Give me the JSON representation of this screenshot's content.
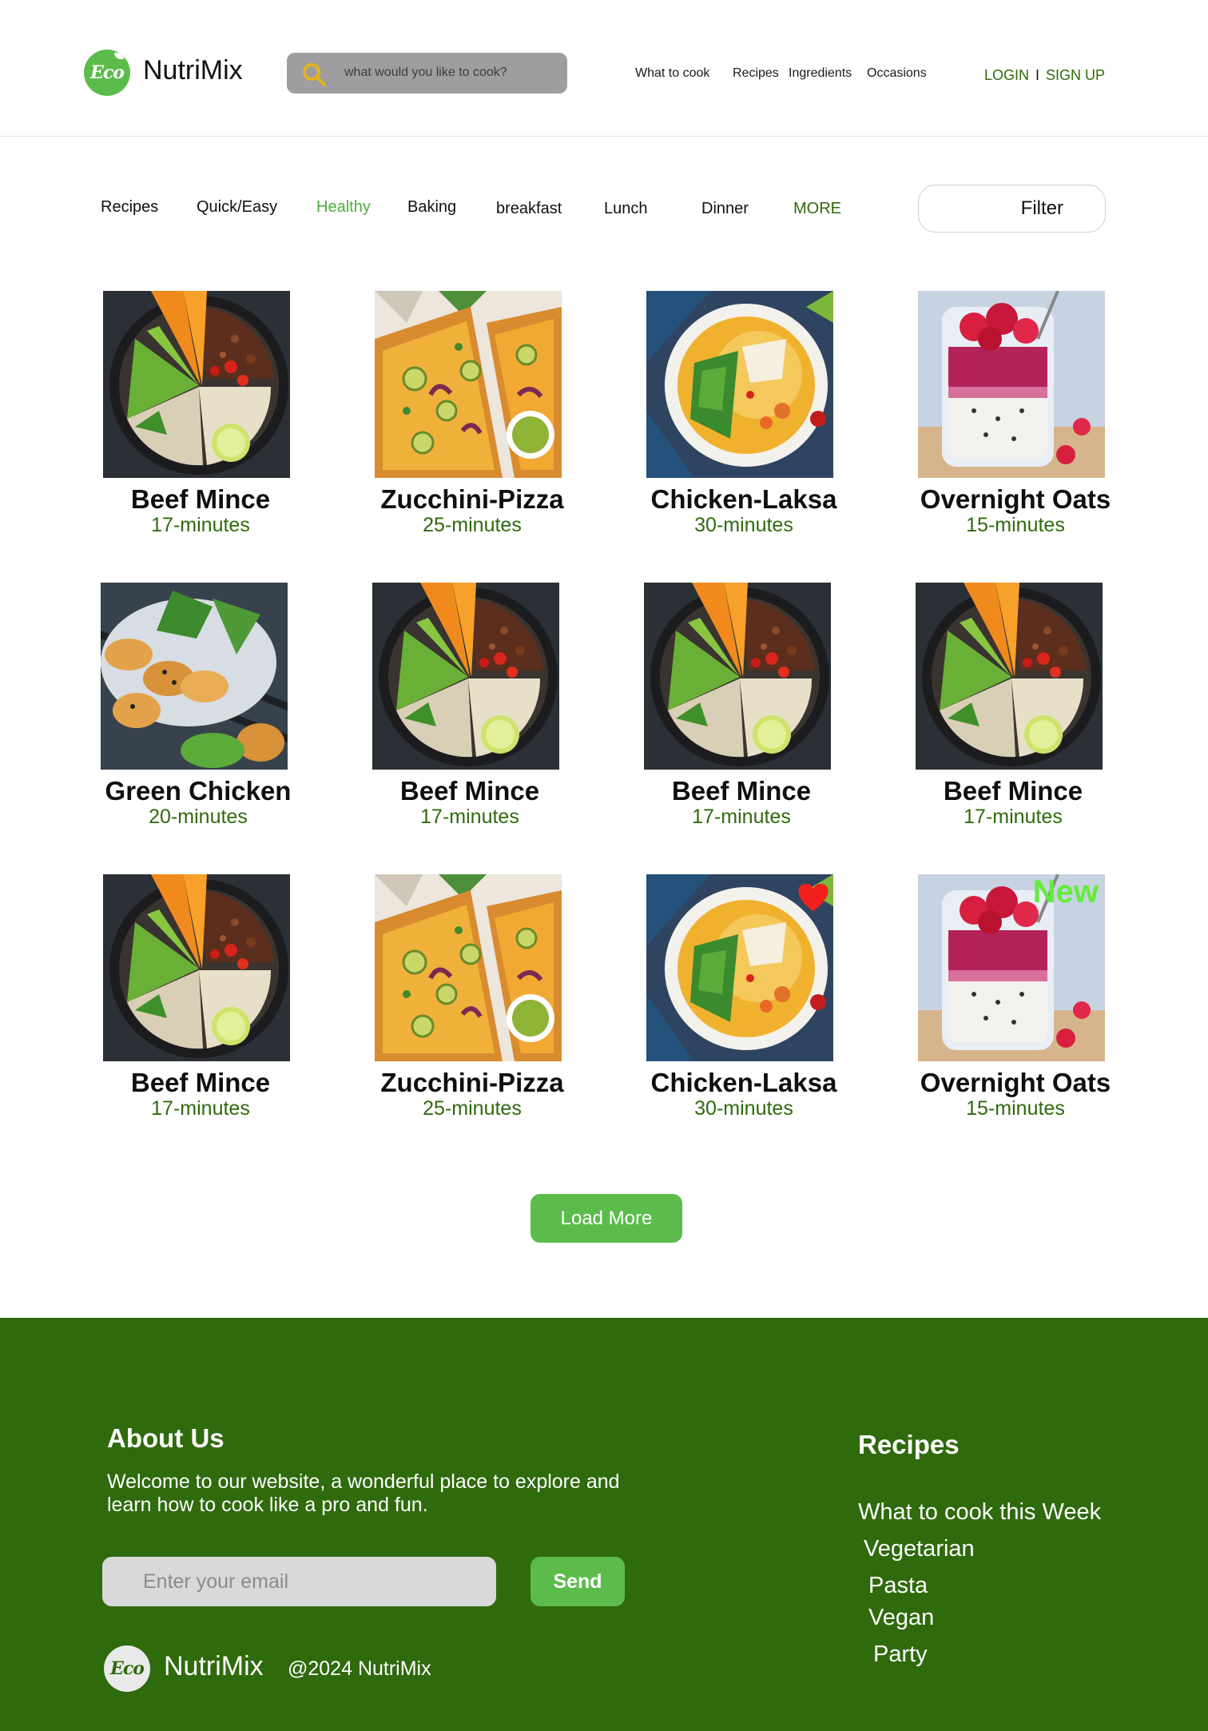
{
  "header": {
    "brand": "NutriMix",
    "search_placeholder": "what would you like to cook?",
    "nav": [
      "What to cook",
      "Recipes",
      "Ingredients",
      "Occasions"
    ],
    "login": "LOGIN",
    "separator": "I",
    "signup": "SIGN UP"
  },
  "tabs": {
    "items": [
      "Recipes",
      "Quick/Easy",
      "Healthy",
      "Baking",
      "breakfast",
      "Lunch",
      "Dinner",
      "MORE"
    ],
    "active": "Healthy",
    "filter_label": "Filter"
  },
  "recipes": [
    {
      "title": "Beef Mince",
      "time": "17-minutes"
    },
    {
      "title": "Zucchini-Pizza",
      "time": "25-minutes"
    },
    {
      "title": "Chicken-Laksa",
      "time": "30-minutes"
    },
    {
      "title": "Overnight Oats",
      "time": "15-minutes"
    },
    {
      "title": "Green Chicken",
      "time": "20-minutes"
    },
    {
      "title": "Beef Mince",
      "time": "17-minutes"
    },
    {
      "title": "Beef Mince",
      "time": "17-minutes"
    },
    {
      "title": "Beef Mince",
      "time": "17-minutes"
    },
    {
      "title": "Beef Mince",
      "time": "17-minutes"
    },
    {
      "title": "Zucchini-Pizza",
      "time": "25-minutes"
    },
    {
      "title": "Chicken-Laksa",
      "time": "30-minutes",
      "favorite": true
    },
    {
      "title": "Overnight Oats",
      "time": "15-minutes",
      "badge": "New"
    }
  ],
  "load_more": "Load More",
  "footer": {
    "about_title": "About Us",
    "about_text": "Welcome to our website, a wonderful place to explore and learn how to cook like a pro and fun.",
    "email_placeholder": "Enter your email",
    "send_label": "Send",
    "brand": "NutriMix",
    "copyright": "@2024 NutriMix",
    "recipes_title": "Recipes",
    "recipe_links": [
      "What to cook this Week",
      "Vegetarian",
      "Pasta",
      "Vegan",
      "Party"
    ]
  },
  "logo_text": "Eco",
  "colors": {
    "brand_green": "#5cbc4b",
    "dark_green": "#2f6a0d",
    "new_badge": "#63ec3a",
    "heart": "#f2201c",
    "search_icon": "#e5b31c"
  }
}
